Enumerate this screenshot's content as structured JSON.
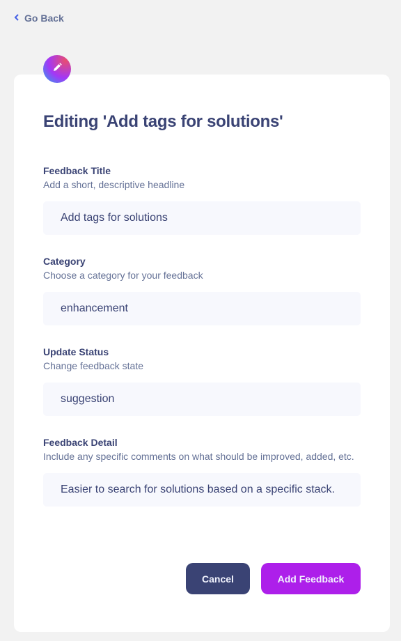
{
  "nav": {
    "back_label": "Go Back"
  },
  "page": {
    "title": "Editing 'Add tags for solutions'"
  },
  "fields": [
    {
      "label": "Feedback Title",
      "description": "Add a short, descriptive headline",
      "value": "Add tags for solutions"
    },
    {
      "label": "Category",
      "description": "Choose a category for your feedback",
      "value": "enhancement"
    },
    {
      "label": "Update Status",
      "description": "Change feedback state",
      "value": "suggestion"
    },
    {
      "label": "Feedback Detail",
      "description": "Include any specific comments on what should be improved, added, etc.",
      "value": "Easier to search for solutions based on a specific stack."
    }
  ],
  "actions": {
    "cancel_label": "Cancel",
    "submit_label": "Add Feedback"
  },
  "colors": {
    "primary": "#3a4374",
    "accent": "#ad1fea",
    "muted": "#647196",
    "input_bg": "#f7f8fd"
  },
  "icons": {
    "back": "chevron-left-icon",
    "badge": "pen-icon"
  }
}
